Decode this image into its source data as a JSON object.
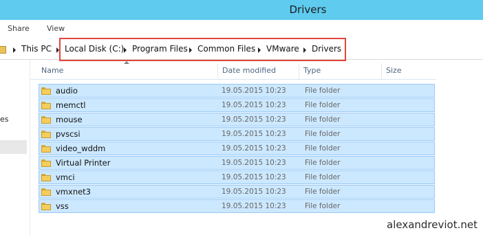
{
  "window": {
    "title": "Drivers"
  },
  "ribbon": {
    "tabs": [
      "Share",
      "View"
    ]
  },
  "address": {
    "crumbs": [
      "This PC",
      "Local Disk (C:)",
      "Program Files",
      "Common Files",
      "VMware",
      "Drivers"
    ]
  },
  "navpane": {
    "partial_text": "es"
  },
  "columns": [
    "Name",
    "Date modified",
    "Type",
    "Size"
  ],
  "rows": [
    {
      "name": "audio",
      "date": "19.05.2015 10:23",
      "type": "File folder"
    },
    {
      "name": "memctl",
      "date": "19.05.2015 10:23",
      "type": "File folder"
    },
    {
      "name": "mouse",
      "date": "19.05.2015 10:23",
      "type": "File folder"
    },
    {
      "name": "pvscsi",
      "date": "19.05.2015 10:23",
      "type": "File folder"
    },
    {
      "name": "video_wddm",
      "date": "19.05.2015 10:23",
      "type": "File folder"
    },
    {
      "name": "Virtual Printer",
      "date": "19.05.2015 10:23",
      "type": "File folder"
    },
    {
      "name": "vmci",
      "date": "19.05.2015 10:23",
      "type": "File folder"
    },
    {
      "name": "vmxnet3",
      "date": "19.05.2015 10:23",
      "type": "File folder"
    },
    {
      "name": "vss",
      "date": "19.05.2015 10:23",
      "type": "File folder"
    }
  ],
  "watermark": "alexandreviot.net",
  "colors": {
    "titlebar": "#5ecbef",
    "selection": "#cce8ff",
    "selection_border": "#99c9f5",
    "highlight_box": "#e0463a",
    "folder": "#f4cd5b"
  }
}
